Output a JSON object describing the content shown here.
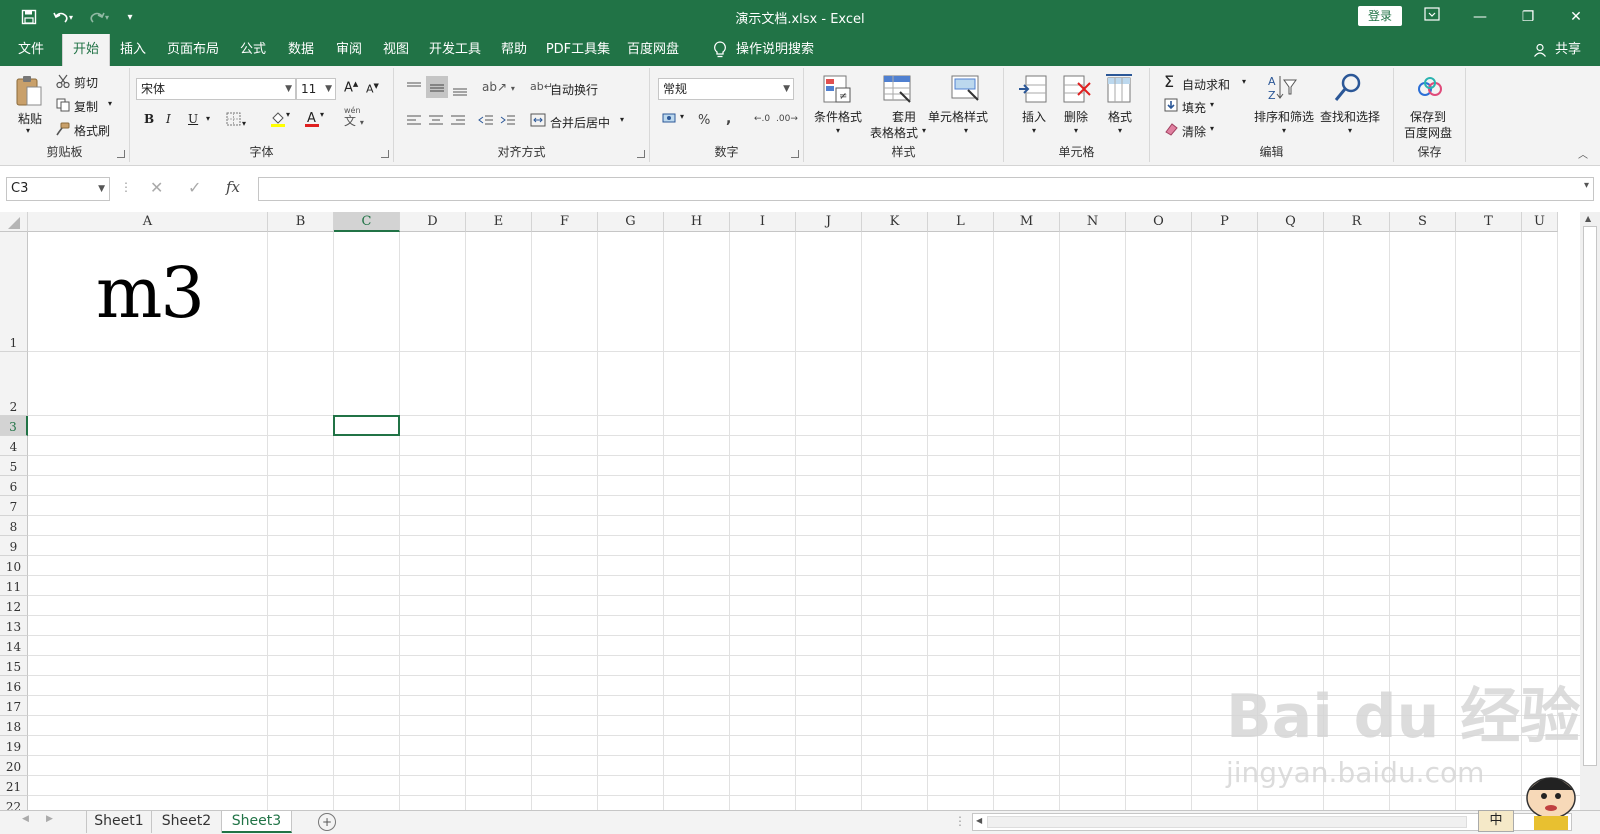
{
  "titlebar": {
    "title": "演示文档.xlsx  -  Excel",
    "login": "登录",
    "minimize": "—",
    "restore": "❐",
    "close": "✕"
  },
  "tabs": [
    "文件",
    "开始",
    "插入",
    "页面布局",
    "公式",
    "数据",
    "审阅",
    "视图",
    "开发工具",
    "帮助",
    "PDF工具集",
    "百度网盘"
  ],
  "active_tab": "开始",
  "tell_me": "操作说明搜索",
  "share": "共享",
  "ribbon": {
    "clipboard": {
      "label": "剪贴板",
      "paste": "粘贴",
      "cut": "剪切",
      "copy": "复制",
      "format_painter": "格式刷"
    },
    "font": {
      "label": "字体",
      "font_name": "宋体",
      "font_size": "11",
      "bold": "B",
      "italic": "I",
      "underline": "U",
      "pinyin": "文"
    },
    "alignment": {
      "label": "对齐方式",
      "wrap": "自动换行",
      "merge": "合并后居中"
    },
    "number": {
      "label": "数字",
      "format": "常规",
      "percent": "%",
      "comma": ","
    },
    "styles": {
      "label": "样式",
      "conditional": "条件格式",
      "table1": "套用",
      "table2": "表格格式",
      "cell_styles": "单元格样式"
    },
    "cells": {
      "label": "单元格",
      "insert": "插入",
      "delete": "删除",
      "format": "格式"
    },
    "editing": {
      "label": "编辑",
      "autosum": "自动求和",
      "fill": "填充",
      "clear": "清除",
      "sort": "排序和筛选",
      "find": "查找和选择"
    },
    "save": {
      "label": "保存",
      "save1": "保存到",
      "save2": "百度网盘"
    }
  },
  "formula_bar": {
    "name_box": "C3",
    "fx": "fx",
    "formula": ""
  },
  "columns": [
    "A",
    "B",
    "C",
    "D",
    "E",
    "F",
    "G",
    "H",
    "I",
    "J",
    "K",
    "L",
    "M",
    "N",
    "O",
    "P",
    "Q",
    "R",
    "S",
    "T",
    "U"
  ],
  "rows": [
    "1",
    "2",
    "3",
    "4",
    "5",
    "6",
    "7",
    "8",
    "9",
    "10",
    "11",
    "12",
    "13",
    "14",
    "15",
    "16",
    "17",
    "18",
    "19",
    "20",
    "21",
    "22"
  ],
  "cells": {
    "A1": "m3"
  },
  "selected_cell": "C3",
  "sheets": [
    "Sheet1",
    "Sheet2",
    "Sheet3"
  ],
  "active_sheet": "Sheet3",
  "ime": "中",
  "watermark": {
    "brand": "Bai du 经验",
    "url": "jingyan.baidu.com"
  },
  "colors": {
    "accent": "#217346"
  }
}
